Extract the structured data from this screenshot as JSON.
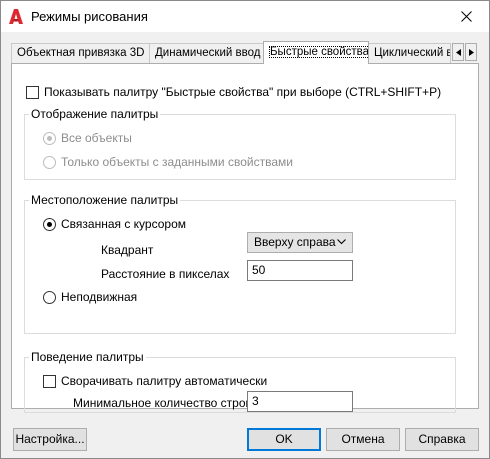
{
  "window": {
    "title": "Режимы рисования",
    "accent_color": "#0078d7",
    "app_icon": "autocad-a-icon"
  },
  "tabs": [
    {
      "label": "Объектная привязка 3D",
      "active": false
    },
    {
      "label": "Динамический ввод",
      "active": false
    },
    {
      "label": "Быстрые свойства",
      "active": true
    },
    {
      "label": "Циклический в",
      "active": false
    }
  ],
  "panel": {
    "show_palette_checkbox": {
      "label": "Показывать палитру \"Быстрые свойства\" при выборе (CTRL+SHIFT+P)",
      "checked": false
    },
    "display_group": {
      "title": "Отображение палитры",
      "options": [
        {
          "label": "Все объекты",
          "checked": true,
          "enabled": false
        },
        {
          "label": "Только объекты с заданными свойствами",
          "checked": false,
          "enabled": false
        }
      ]
    },
    "location_group": {
      "title": "Местоположение палитры",
      "cursor_option": {
        "label": "Связанная с курсором",
        "checked": true
      },
      "quadrant_label": "Квадрант",
      "quadrant_value": "Вверху справа",
      "distance_label": "Расстояние в пикселах",
      "distance_value": "50",
      "fixed_option": {
        "label": "Неподвижная",
        "checked": false
      }
    },
    "behavior_group": {
      "title": "Поведение палитры",
      "collapse_checkbox": {
        "label": "Сворачивать палитру автоматически",
        "checked": false
      },
      "min_rows_label": "Минимальное количество строк",
      "min_rows_value": "3"
    }
  },
  "buttons": {
    "settings": "Настройка...",
    "ok": "OK",
    "cancel": "Отмена",
    "help": "Справка"
  }
}
